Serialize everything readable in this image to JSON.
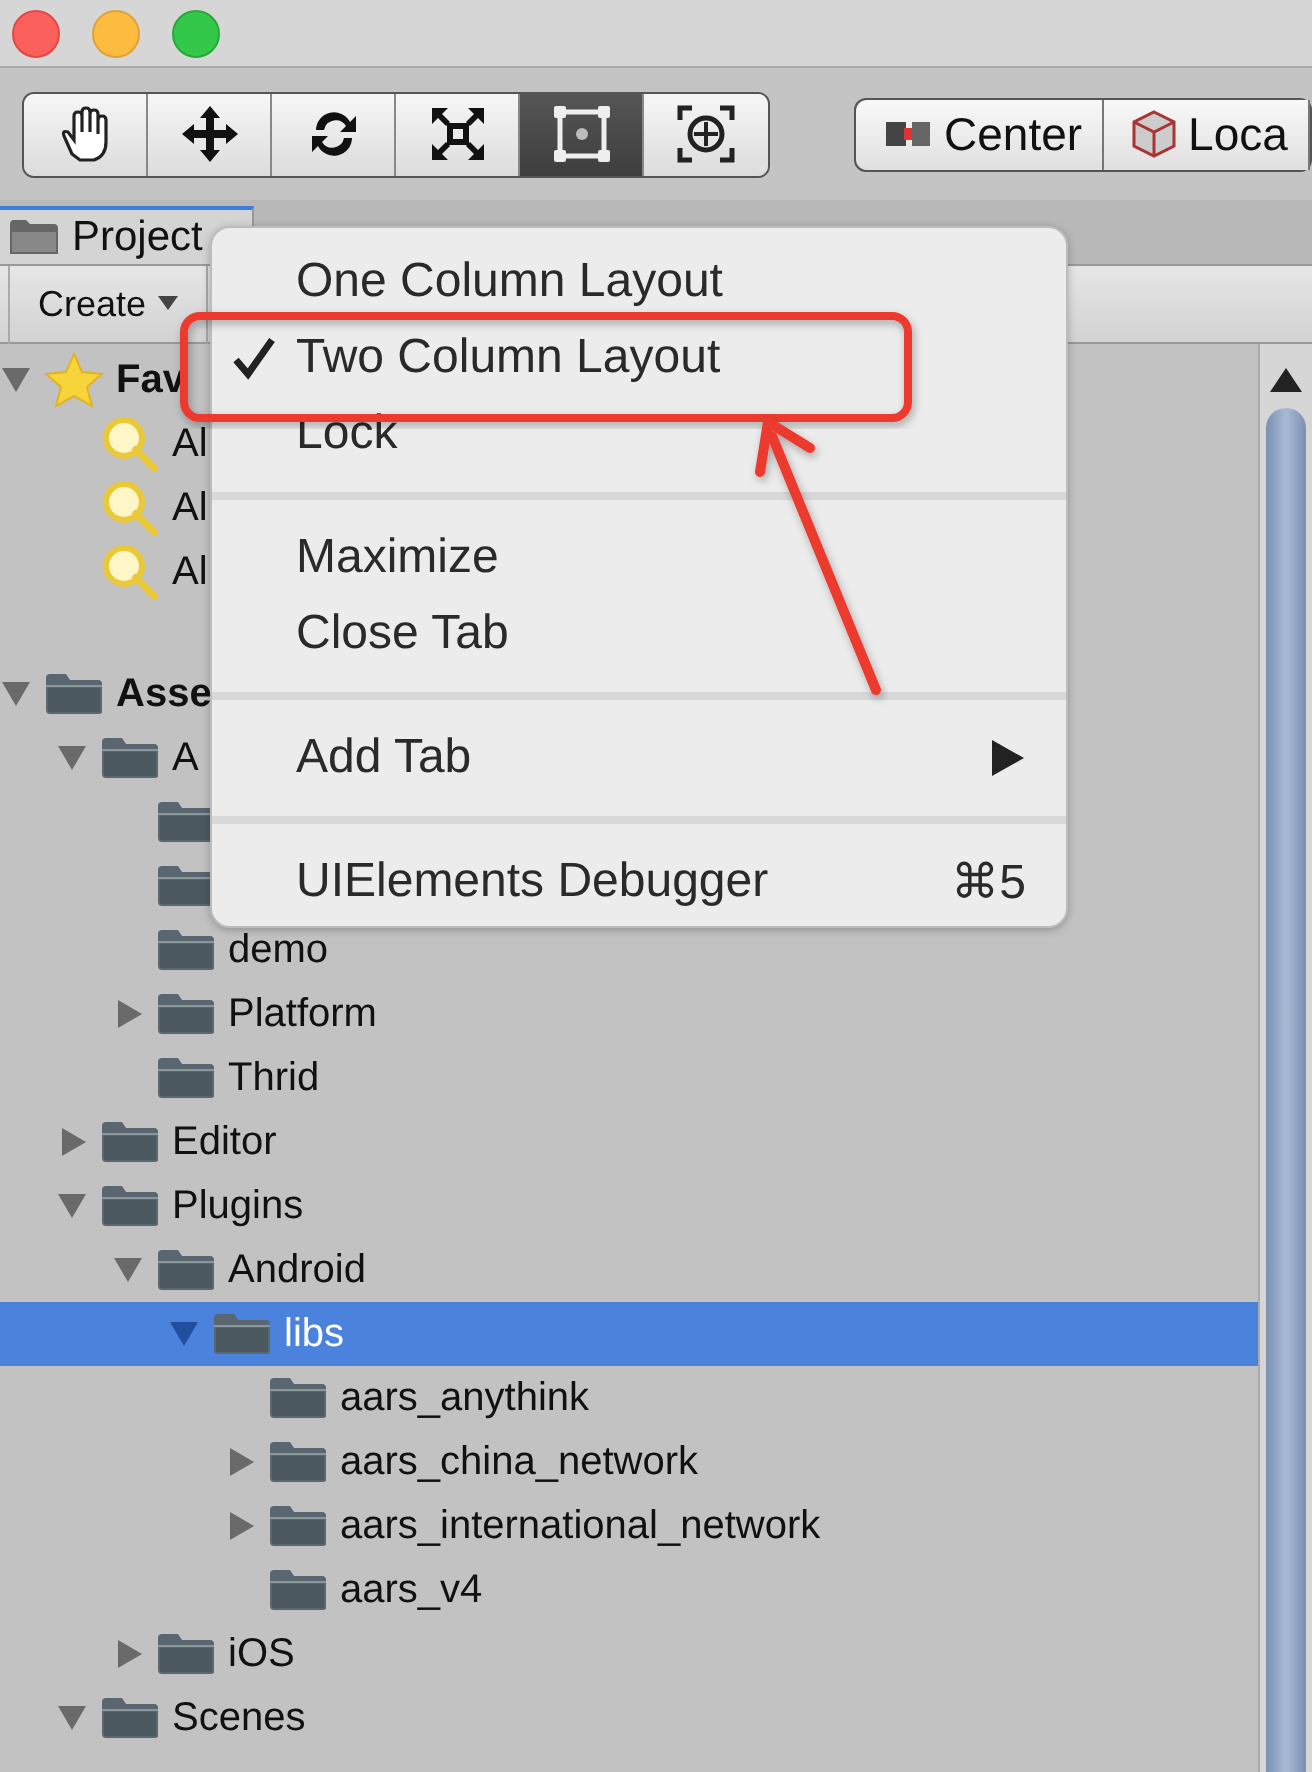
{
  "tools": [
    {
      "kind": "hand",
      "selected": false
    },
    {
      "kind": "move",
      "selected": false
    },
    {
      "kind": "rotate",
      "selected": false
    },
    {
      "kind": "scale",
      "selected": false
    },
    {
      "kind": "rect",
      "selected": true
    },
    {
      "kind": "transform",
      "selected": false
    }
  ],
  "pivot_buttons": [
    {
      "kind": "pivot",
      "label": "Center"
    },
    {
      "kind": "space",
      "label": "Loca"
    }
  ],
  "project_tab": {
    "title": "Project"
  },
  "create_button": {
    "label": "Create"
  },
  "tree": [
    {
      "kind": "favorites",
      "label": "Fav",
      "expanded": true,
      "selected": false,
      "children": [
        {
          "kind": "search",
          "label": "Al",
          "selected": false
        },
        {
          "kind": "search",
          "label": "Al",
          "selected": false
        },
        {
          "kind": "search",
          "label": "Al",
          "selected": false
        }
      ]
    },
    {
      "kind": "folder",
      "label": "Asse",
      "expanded": true,
      "selected": false,
      "children": [
        {
          "kind": "folder",
          "label": "A",
          "expanded": true,
          "selected": false,
          "children": [
            {
              "kind": "folder",
              "selected": false
            },
            {
              "kind": "folder",
              "selected": false
            },
            {
              "kind": "folder",
              "label": "demo",
              "selected": false
            },
            {
              "kind": "folder",
              "label": "Platform",
              "expanded": false,
              "selected": false
            },
            {
              "kind": "folder",
              "label": "Thrid",
              "selected": false
            }
          ]
        },
        {
          "kind": "folder",
          "label": "Editor",
          "expanded": false,
          "selected": false
        },
        {
          "kind": "folder",
          "label": "Plugins",
          "expanded": true,
          "selected": false,
          "children": [
            {
              "kind": "folder",
              "label": "Android",
              "expanded": true,
              "selected": false,
              "children": [
                {
                  "kind": "folder",
                  "label": "libs",
                  "expanded": true,
                  "selected": true,
                  "children": [
                    {
                      "kind": "folder",
                      "label": "aars_anythink",
                      "selected": false
                    },
                    {
                      "kind": "folder",
                      "label": "aars_china_network",
                      "expanded": false,
                      "selected": false
                    },
                    {
                      "kind": "folder",
                      "label": "aars_international_network",
                      "expanded": false,
                      "selected": false
                    },
                    {
                      "kind": "folder",
                      "label": "aars_v4",
                      "selected": false
                    }
                  ]
                }
              ]
            },
            {
              "kind": "folder",
              "label": "iOS",
              "expanded": false,
              "selected": false
            }
          ]
        },
        {
          "kind": "folder",
          "label": "Scenes",
          "expanded": true,
          "selected": false
        }
      ]
    }
  ],
  "menu": {
    "groups": [
      [
        {
          "label": "One Column Layout",
          "checked": false,
          "submenu": false
        },
        {
          "label": "Two Column Layout",
          "checked": true,
          "submenu": false
        },
        {
          "label": "Lock",
          "checked": false,
          "submenu": false
        }
      ],
      [
        {
          "label": "Maximize",
          "checked": false,
          "submenu": false
        },
        {
          "label": "Close Tab",
          "checked": false,
          "submenu": false
        }
      ],
      [
        {
          "label": "Add Tab",
          "checked": false,
          "submenu": true
        }
      ],
      [
        {
          "label": "UIElements Debugger",
          "shortcut": "⌘5",
          "checked": false,
          "submenu": false
        }
      ]
    ]
  },
  "annotations": [
    {
      "kind": "frame"
    },
    {
      "kind": "arrow"
    }
  ]
}
